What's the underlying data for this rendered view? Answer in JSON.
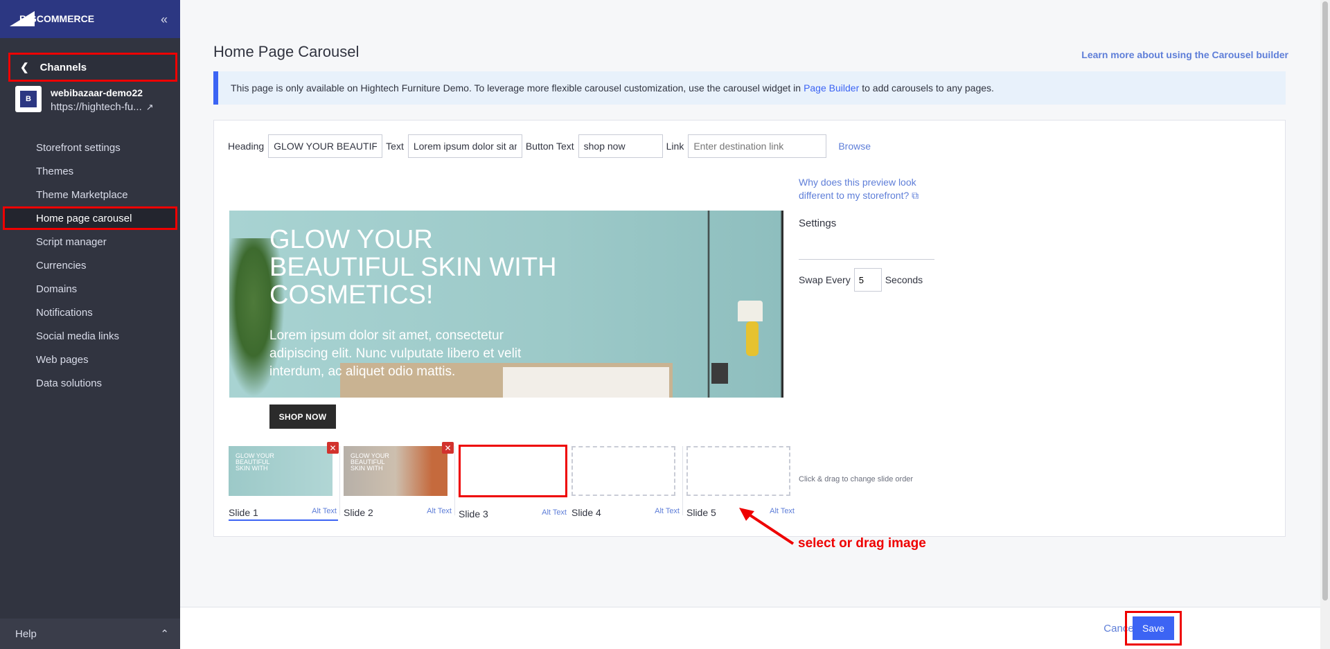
{
  "sidebar": {
    "logo_big": "BIG",
    "logo_commerce": "COMMERCE",
    "collapse_icon": "«",
    "channels_label": "Channels",
    "store_icon": "B",
    "store_name": "webibazaar-demo22",
    "store_url": "https://hightech-fu...",
    "nav": [
      "Storefront settings",
      "Themes",
      "Theme Marketplace",
      "Home page carousel",
      "Script manager",
      "Currencies",
      "Domains",
      "Notifications",
      "Social media links",
      "Web pages",
      "Data solutions"
    ],
    "help_label": "Help"
  },
  "main": {
    "title": "Home Page Carousel",
    "learn_link": "Learn more about using the Carousel builder",
    "info_pre": "This page is only available on Hightech Furniture Demo. To leverage more flexible carousel customization, use the carousel widget in",
    "info_link": "Page Builder",
    "info_post": "to add carousels to any pages."
  },
  "form": {
    "heading_label": "Heading",
    "heading_value": "GLOW YOUR BEAUTIFUL",
    "text_label": "Text",
    "text_value": "Lorem ipsum dolor sit am",
    "button_label": "Button Text",
    "button_value": "shop now",
    "link_label": "Link",
    "link_placeholder": "Enter destination link",
    "browse": "Browse"
  },
  "preview": {
    "heading": "GLOW YOUR BEAUTIFUL SKIN WITH COSMETICS!",
    "text": "Lorem ipsum dolor sit amet, consectetur adipiscing elit. Nunc vulputate libero et velit interdum, ac aliquet odio mattis.",
    "button": "SHOP NOW"
  },
  "settings": {
    "why": "Why does this preview look different to my storefront?",
    "label": "Settings",
    "swap_label": "Swap Every",
    "swap_value": "5",
    "seconds": "Seconds",
    "drag_hint": "Click & drag to change slide order"
  },
  "slides": [
    {
      "label": "Slide 1",
      "alt": "Alt Text",
      "thumb_text": "GLOW YOUR BEAUTIFUL SKIN WITH"
    },
    {
      "label": "Slide 2",
      "alt": "Alt Text",
      "thumb_text": "GLOW YOUR BEAUTIFUL SKIN WITH"
    },
    {
      "label": "Slide 3",
      "alt": "Alt Text"
    },
    {
      "label": "Slide 4",
      "alt": "Alt Text"
    },
    {
      "label": "Slide 5",
      "alt": "Alt Text"
    }
  ],
  "annotation": "select or drag image",
  "footer": {
    "cancel": "Cancel",
    "save": "Save"
  }
}
